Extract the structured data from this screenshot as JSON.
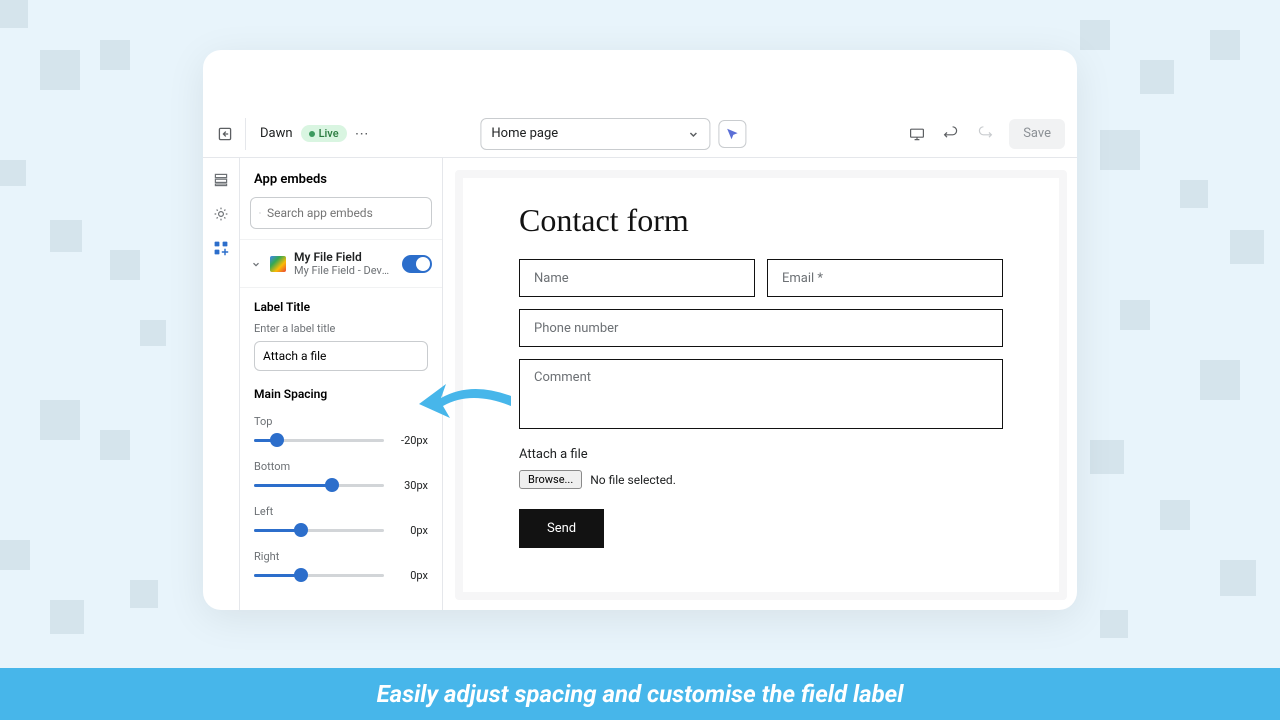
{
  "topbar": {
    "theme_name": "Dawn",
    "live_badge": "Live",
    "page_selector": "Home page",
    "save_label": "Save"
  },
  "sidebar": {
    "heading": "App embeds",
    "search_placeholder": "Search app embeds",
    "embed": {
      "name": "My File Field",
      "subtitle": "My File Field - Develop...",
      "enabled": true
    },
    "label_title_heading": "Label Title",
    "label_title_hint": "Enter a label title",
    "label_title_value": "Attach a file",
    "main_spacing_heading": "Main Spacing",
    "sliders": {
      "top": {
        "label": "Top",
        "value": "-20px",
        "percent": 18
      },
      "bottom": {
        "label": "Bottom",
        "value": "30px",
        "percent": 60
      },
      "left": {
        "label": "Left",
        "value": "0px",
        "percent": 36
      },
      "right": {
        "label": "Right",
        "value": "0px",
        "percent": 36
      }
    }
  },
  "preview": {
    "form_title": "Contact form",
    "name_placeholder": "Name",
    "email_placeholder": "Email *",
    "phone_placeholder": "Phone number",
    "comment_placeholder": "Comment",
    "attach_label": "Attach a file",
    "browse_label": "Browse...",
    "file_status": "No file selected.",
    "send_label": "Send"
  },
  "banner_text": "Easily adjust spacing and customise the field label"
}
